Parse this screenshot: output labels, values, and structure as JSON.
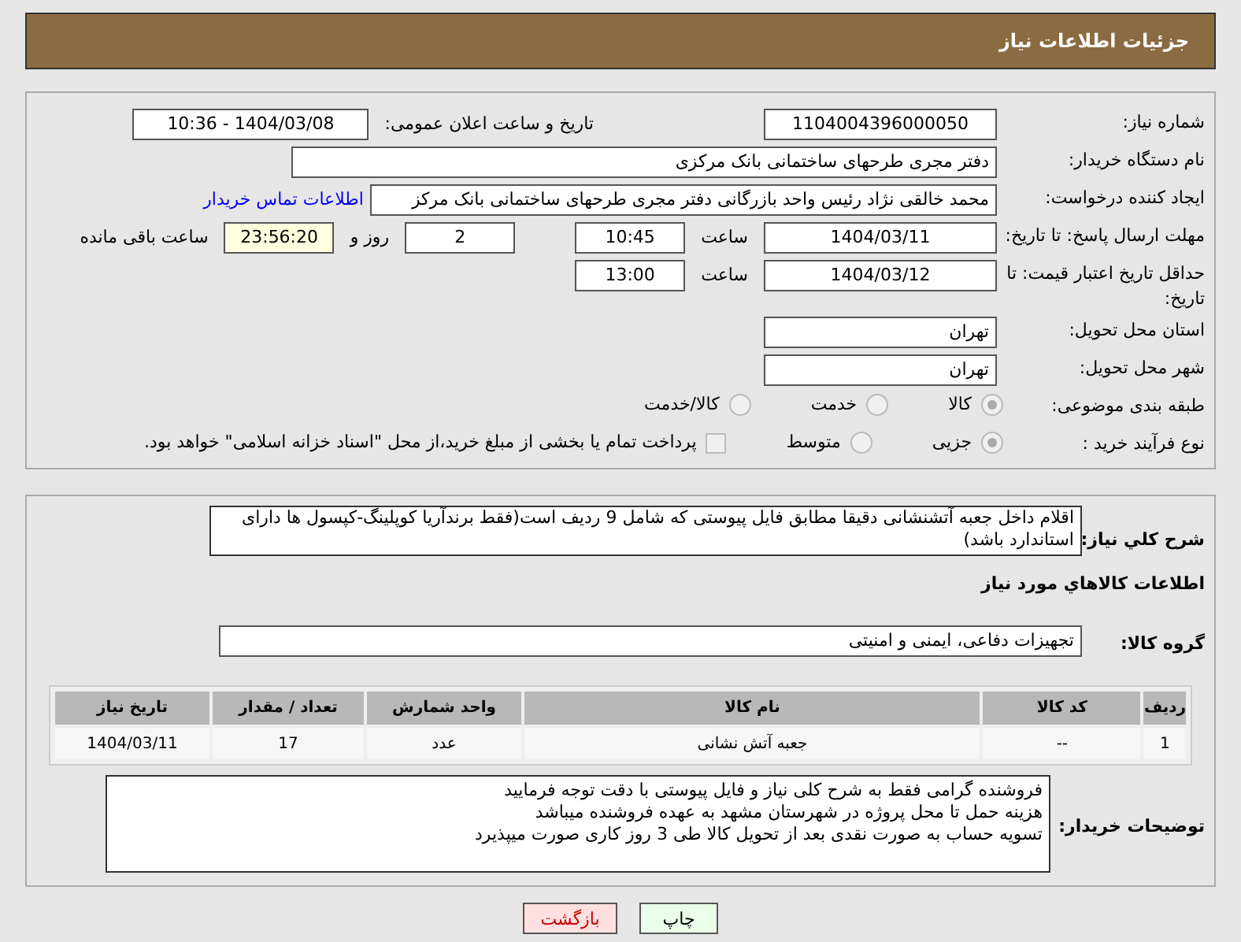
{
  "header": {
    "title": "جزئیات اطلاعات نیاز"
  },
  "need_number": {
    "label": "شماره نیاز:",
    "value": "1104004396000050"
  },
  "announce": {
    "label": "تاریخ و ساعت اعلان عمومی:",
    "value": "1404/03/08 - 10:36"
  },
  "buyer_org": {
    "label": "نام دستگاه خریدار:",
    "value": "دفتر مجری طرحهای ساختمانی بانک مرکزی"
  },
  "requester": {
    "label": "ایجاد کننده درخواست:",
    "value": "محمد خالقی نژاد رئیس واحد بازرگانی دفتر مجری طرحهای ساختمانی بانک مرکز",
    "link": "اطلاعات تماس خریدار"
  },
  "deadline": {
    "label": "مهلت ارسال پاسخ: تا تاریخ:",
    "date": "1404/03/11",
    "time_label": "ساعت",
    "time": "10:45",
    "days": "2",
    "days_label": "روز و",
    "remaining": "23:56:20",
    "remaining_label": "ساعت باقی مانده"
  },
  "price_validity": {
    "label": "حداقل تاریخ اعتبار قیمت: تا تاریخ:",
    "date": "1404/03/12",
    "time_label": "ساعت",
    "time": "13:00"
  },
  "province": {
    "label": "استان محل تحویل:",
    "value": "تهران"
  },
  "city": {
    "label": "شهر محل تحویل:",
    "value": "تهران"
  },
  "category": {
    "label": "طبقه بندی موضوعی:",
    "options": [
      {
        "label": "کالا",
        "selected": true
      },
      {
        "label": "خدمت",
        "selected": false
      },
      {
        "label": "کالا/خدمت",
        "selected": false
      }
    ]
  },
  "process": {
    "label": "نوع فرآیند خرید :",
    "options": [
      {
        "label": "جزیی",
        "selected": true
      },
      {
        "label": "متوسط",
        "selected": false
      }
    ],
    "treasury": {
      "checked": false,
      "text": "پرداخت تمام یا بخشی از مبلغ خرید،از محل \"اسناد خزانه اسلامی\" خواهد بود."
    }
  },
  "description": {
    "label": "شرح کلي نياز:",
    "value": "اقلام داخل جعبه آتشنشانی دقیقا مطابق فایل پیوستی که شامل 9 ردیف است(فقط برندآریا کوپلینگ-کپسول ها دارای استاندارد باشد)"
  },
  "goods_heading": "اطلاعات کالاهاي مورد نياز",
  "goods_group": {
    "label": "گروه کالا:",
    "value": "تجهیزات دفاعی، ایمنی و امنیتی"
  },
  "table": {
    "columns": [
      "ردیف",
      "کد کالا",
      "نام کالا",
      "واحد شمارش",
      "تعداد / مقدار",
      "تاریخ نیاز"
    ],
    "rows": [
      [
        "1",
        "--",
        "جعبه آتش نشانی",
        "عدد",
        "17",
        "1404/03/11"
      ]
    ]
  },
  "notes": {
    "label": "توضیحات خریدار:",
    "lines": [
      "فروشنده گرامی فقط به شرح کلی نیاز و فایل پیوستی با دقت توجه فرمایید",
      "هزینه حمل تا محل پروژه در شهرستان مشهد به عهده فروشنده میباشد",
      "تسویه حساب به صورت نقدی بعد از تحویل کالا طی 3 روز کاری صورت میپذیرد"
    ]
  },
  "buttons": [
    {
      "label": "چاپ",
      "kind": "print"
    },
    {
      "label": "بازگشت",
      "kind": "back"
    }
  ]
}
